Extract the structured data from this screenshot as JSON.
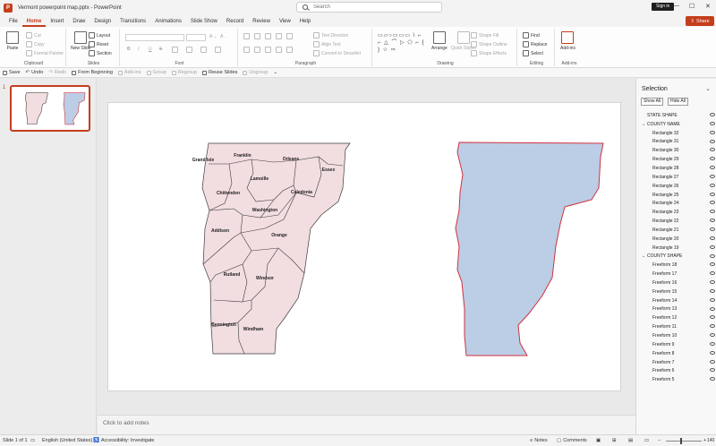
{
  "window": {
    "title": "Vermont powerpoint map.pptx  -  PowerPoint",
    "search_placeholder": "Search",
    "sign_in": "Sign in",
    "minimize": "—",
    "maximize": "☐",
    "close": "✕"
  },
  "tabs": [
    "File",
    "Home",
    "Insert",
    "Draw",
    "Design",
    "Transitions",
    "Animations",
    "Slide Show",
    "Record",
    "Review",
    "View",
    "Help"
  ],
  "share_label": "Share",
  "ribbon": {
    "clipboard": {
      "label": "Clipboard",
      "paste": "Paste",
      "cut": "Cut",
      "copy": "Copy",
      "format_painter": "Format Painter"
    },
    "slides": {
      "label": "Slides",
      "new_slide": "New Slide",
      "layout": "Layout",
      "reset": "Reset",
      "section": "Section"
    },
    "font": {
      "label": "Font",
      "bold": "B",
      "italic": "I",
      "underline": "U",
      "strike": "S"
    },
    "paragraph": {
      "label": "Paragraph",
      "text_direction": "Text Direction",
      "align_text": "Align Text",
      "convert_smartart": "Convert to SmartArt"
    },
    "drawing": {
      "label": "Drawing",
      "arrange": "Arrange",
      "quick_styles": "Quick Styles",
      "shape_fill": "Shape Fill",
      "shape_outline": "Shape Outline",
      "shape_effects": "Shape Effects",
      "shapes_glyphs": "▭▱○▭▭▭ \\ ⌐ ⌐ △ ⌒ ▷ ⬠ ⌐ { } ☆ ⇨"
    },
    "editing": {
      "label": "Editing",
      "find": "Find",
      "replace": "Replace",
      "select": "Select"
    },
    "addins": {
      "label": "Add-ins",
      "addins": "Add-ins"
    }
  },
  "quick_access": {
    "save": "Save",
    "undo": "Undo",
    "redo": "Redo",
    "from_beginning": "From Beginning",
    "addins": "Add-ins",
    "group": "Group",
    "regroup": "Regroup",
    "reuse_slides": "Reuse Slides",
    "ungroup": "Ungroup"
  },
  "thumbnail_number": "1",
  "counties": [
    {
      "name": "Grand Isle"
    },
    {
      "name": "Franklin"
    },
    {
      "name": "Orleans"
    },
    {
      "name": "Essex"
    },
    {
      "name": "Lamoille"
    },
    {
      "name": "Chittenden"
    },
    {
      "name": "Caledonia"
    },
    {
      "name": "Washington"
    },
    {
      "name": "Addison"
    },
    {
      "name": "Orange"
    },
    {
      "name": "Rutland"
    },
    {
      "name": "Windsor"
    },
    {
      "name": "Bennington"
    },
    {
      "name": "Windham"
    }
  ],
  "colors": {
    "accent": "#c43e1c",
    "county_fill": "#f2dde0",
    "state_fill": "#bccde6",
    "state_stroke": "#d0323c"
  },
  "notes_placeholder": "Click to add notes",
  "selection_pane": {
    "title": "Selection",
    "show_all": "Show All",
    "hide_all": "Hide All",
    "items": [
      {
        "label": "STATE SHAPE",
        "level": 0,
        "caret": ""
      },
      {
        "label": "COUNTY NAME",
        "level": 0,
        "caret": "⌄"
      },
      {
        "label": "Rectangle 32",
        "level": 1,
        "caret": ""
      },
      {
        "label": "Rectangle 31",
        "level": 1,
        "caret": ""
      },
      {
        "label": "Rectangle 30",
        "level": 1,
        "caret": ""
      },
      {
        "label": "Rectangle 29",
        "level": 1,
        "caret": ""
      },
      {
        "label": "Rectangle 28",
        "level": 1,
        "caret": ""
      },
      {
        "label": "Rectangle 27",
        "level": 1,
        "caret": ""
      },
      {
        "label": "Rectangle 26",
        "level": 1,
        "caret": ""
      },
      {
        "label": "Rectangle 25",
        "level": 1,
        "caret": ""
      },
      {
        "label": "Rectangle 24",
        "level": 1,
        "caret": ""
      },
      {
        "label": "Rectangle 23",
        "level": 1,
        "caret": ""
      },
      {
        "label": "Rectangle 22",
        "level": 1,
        "caret": ""
      },
      {
        "label": "Rectangle 21",
        "level": 1,
        "caret": ""
      },
      {
        "label": "Rectangle 20",
        "level": 1,
        "caret": ""
      },
      {
        "label": "Rectangle 19",
        "level": 1,
        "caret": ""
      },
      {
        "label": "COUNTY SHAPE",
        "level": 0,
        "caret": "⌄"
      },
      {
        "label": "Freeform 18",
        "level": 1,
        "caret": ""
      },
      {
        "label": "Freeform 17",
        "level": 1,
        "caret": ""
      },
      {
        "label": "Freeform 16",
        "level": 1,
        "caret": ""
      },
      {
        "label": "Freeform 15",
        "level": 1,
        "caret": ""
      },
      {
        "label": "Freeform 14",
        "level": 1,
        "caret": ""
      },
      {
        "label": "Freeform 13",
        "level": 1,
        "caret": ""
      },
      {
        "label": "Freeform 12",
        "level": 1,
        "caret": ""
      },
      {
        "label": "Freeform 11",
        "level": 1,
        "caret": ""
      },
      {
        "label": "Freeform 10",
        "level": 1,
        "caret": ""
      },
      {
        "label": "Freeform 9",
        "level": 1,
        "caret": ""
      },
      {
        "label": "Freeform 8",
        "level": 1,
        "caret": ""
      },
      {
        "label": "Freeform 7",
        "level": 1,
        "caret": ""
      },
      {
        "label": "Freeform 6",
        "level": 1,
        "caret": ""
      },
      {
        "label": "Freeform 5",
        "level": 1,
        "caret": ""
      }
    ]
  },
  "status": {
    "slide": "Slide 1 of 1",
    "language": "English (United States)",
    "accessibility": "Accessibility: Investigate",
    "notes": "Notes",
    "comments": "Comments",
    "zoom": "140"
  }
}
